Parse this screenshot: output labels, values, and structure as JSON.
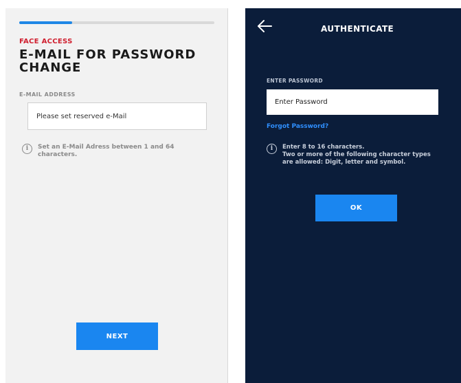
{
  "left": {
    "progress": 0.27,
    "eyebrow": "FACE ACCESS",
    "title": "E-MAIL FOR PASSWORD CHANGE",
    "email_label": "E-MAIL ADDRESS",
    "email_placeholder": "Please set reserved e-Mail",
    "info_text": "Set an E-Mail Adress between 1 and 64 characters.",
    "next_label": "NEXT"
  },
  "right": {
    "title": "AUTHENTICATE",
    "password_label": "ENTER PASSWORD",
    "password_placeholder": "Enter Password",
    "forgot_label": "Forgot Password?",
    "info_lines": [
      "Enter 8 to 16 characters.",
      "Two or more of the following character types",
      "are allowed: Digit, letter and symbol."
    ],
    "ok_label": "OK"
  },
  "icons": {
    "info_glyph": "i",
    "back": "arrow-left-icon"
  },
  "colors": {
    "accent_blue": "#1a86f0",
    "eyebrow_red": "#d01f2f",
    "dark_bg": "#0b1d3a",
    "link_blue": "#2f8fff"
  }
}
